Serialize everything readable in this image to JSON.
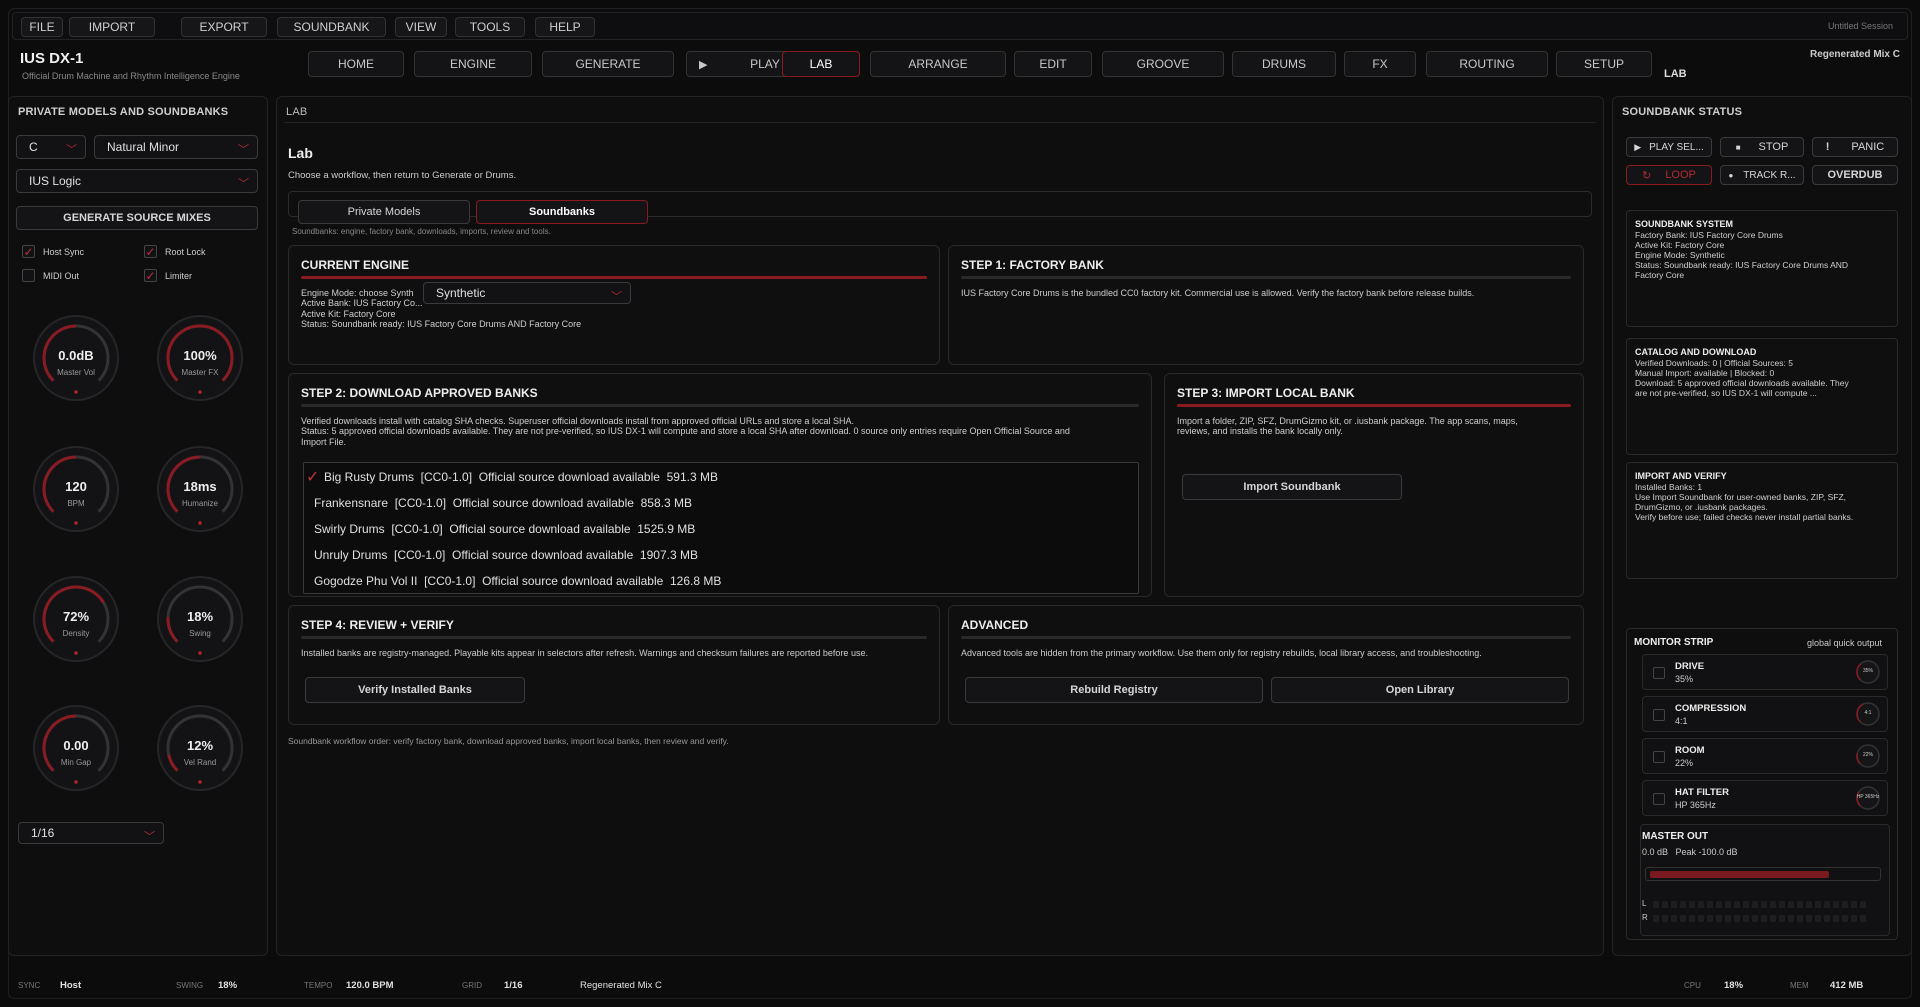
{
  "menu": {
    "file": "FILE",
    "import": "IMPORT",
    "export": "EXPORT",
    "soundbank": "SOUNDBANK",
    "view": "VIEW",
    "tools": "TOOLS",
    "help": "HELP",
    "session": "Untitled Session"
  },
  "app": {
    "title": "IUS DX-1",
    "subtitle": "Official Drum Machine and Rhythm Intelligence Engine",
    "mix": "Regenerated Mix C",
    "section": "LAB"
  },
  "nav": {
    "home": "HOME",
    "engine": "ENGINE",
    "generate": "GENERATE",
    "play": "PLAY",
    "lab": "LAB",
    "arrange": "ARRANGE",
    "edit": "EDIT",
    "groove": "GROOVE",
    "drums": "DRUMS",
    "fx": "FX",
    "routing": "ROUTING",
    "setup": "SETUP"
  },
  "left": {
    "title": "PRIVATE MODELS AND SOUNDBANKS",
    "key": "C",
    "scale": "Natural Minor",
    "model": "IUS Logic",
    "generate": "GENERATE SOURCE MIXES",
    "checks": {
      "host_sync": "Host Sync",
      "root_lock": "Root Lock",
      "midi_out": "MIDI Out",
      "limiter": "Limiter"
    },
    "knobs": [
      {
        "value": "0.0dB",
        "label": "Master Vol",
        "level": 0.5
      },
      {
        "value": "100%",
        "label": "Master FX",
        "level": 1.0
      },
      {
        "value": "120",
        "label": "BPM",
        "level": 0.5
      },
      {
        "value": "18ms",
        "label": "Humanize",
        "level": 0.5
      },
      {
        "value": "72%",
        "label": "Density",
        "level": 0.72
      },
      {
        "value": "18%",
        "label": "Swing",
        "level": 0.18
      },
      {
        "value": "0.00",
        "label": "Min Gap",
        "level": 0.5
      },
      {
        "value": "12%",
        "label": "Vel Rand",
        "level": 0.12
      }
    ],
    "grid": "1/16"
  },
  "lab": {
    "header": "LAB",
    "title": "Lab",
    "desc": "Choose a workflow, then return to Generate or Drums.",
    "tab_private": "Private Models",
    "tab_soundbanks": "Soundbanks",
    "tabs_note": "Soundbanks: engine, factory bank, downloads, imports, review and tools.",
    "engine": {
      "title": "CURRENT ENGINE",
      "l1": "Engine Mode: choose Synth",
      "l2": "Active Bank: IUS Factory Co...",
      "l3": "Active Kit: Factory Core",
      "l4": "Status: Soundbank ready: IUS Factory Core Drums AND Factory Core",
      "mode": "Synthetic"
    },
    "step1": {
      "title": "STEP 1: FACTORY BANK",
      "text": "IUS Factory Core Drums is the bundled CC0 factory kit. Commercial use is allowed. Verify the factory bank before release builds."
    },
    "step2": {
      "title": "STEP 2: DOWNLOAD APPROVED BANKS",
      "t1": "Verified downloads install with catalog SHA checks. Superuser official downloads install from approved official URLs and store a local SHA.",
      "t2": "Status: 5 approved official downloads available. They are not pre-verified, so IUS DX-1 will compute and store a local SHA after download. 0 source only entries require Open Official Source and",
      "t3": "Import File.",
      "banks": [
        "Big Rusty Drums  [CC0-1.0]  Official source download available  591.3 MB",
        "Frankensnare  [CC0-1.0]  Official source download available  858.3 MB",
        "Swirly Drums  [CC0-1.0]  Official source download available  1525.9 MB",
        "Unruly Drums  [CC0-1.0]  Official source download available  1907.3 MB",
        "Gogodze Phu Vol II  [CC0-1.0]  Official source download available  126.8 MB"
      ]
    },
    "step3": {
      "title": "STEP 3: IMPORT LOCAL BANK",
      "t1": "Import a folder, ZIP, SFZ, DrumGizmo kit, or .iusbank package. The app scans, maps,",
      "t2": "reviews, and installs the bank locally only.",
      "button": "Import Soundbank"
    },
    "step4": {
      "title": "STEP 4: REVIEW + VERIFY",
      "text": "Installed banks are registry-managed. Playable kits appear in selectors after refresh. Warnings and checksum failures are reported before use.",
      "button": "Verify Installed Banks"
    },
    "advanced": {
      "title": "ADVANCED",
      "text": "Advanced tools are hidden from the primary workflow. Use them only for registry rebuilds, local library access, and troubleshooting.",
      "rebuild": "Rebuild Registry",
      "open": "Open Library"
    },
    "footer": "Soundbank workflow order: verify factory bank, download approved banks, import local banks, then review and verify."
  },
  "right": {
    "title": "SOUNDBANK STATUS",
    "play_sel": "PLAY SEL...",
    "stop": "STOP",
    "panic": "PANIC",
    "loop": "LOOP",
    "track": "TRACK R...",
    "overdub": "OVERDUB",
    "system": {
      "title": "SOUNDBANK SYSTEM",
      "l1": "Factory Bank: IUS Factory Core Drums",
      "l2": "Active Kit: Factory Core",
      "l3": "Engine Mode: Synthetic",
      "l4": "Status: Soundbank ready: IUS Factory Core Drums AND",
      "l5": "Factory Core"
    },
    "catalog": {
      "title": "CATALOG AND DOWNLOAD",
      "l1": "Verified Downloads: 0 | Official Sources: 5",
      "l2": "Manual Import: available | Blocked: 0",
      "l3": "Download: 5 approved official downloads available. They",
      "l4": "are not pre-verified, so IUS DX-1 will compute ..."
    },
    "importv": {
      "title": "IMPORT AND VERIFY",
      "l1": "Installed Banks: 1",
      "l2": "Use Import Soundbank for user-owned banks, ZIP, SFZ,",
      "l3": "DrumGizmo, or .iusbank packages.",
      "l4": "Verify before use; failed checks never install partial banks."
    },
    "monitor": {
      "title": "MONITOR STRIP",
      "sub": "global quick output",
      "rows": [
        {
          "name": "DRIVE",
          "value": "35%",
          "knob": "35%",
          "level": 0.35
        },
        {
          "name": "COMPRESSION",
          "value": "4:1",
          "knob": "4:1",
          "level": 0.4
        },
        {
          "name": "ROOM",
          "value": "22%",
          "knob": "22%",
          "level": 0.22
        },
        {
          "name": "HAT FILTER",
          "value": "HP 365Hz",
          "knob": "HP 365Hz",
          "level": 0.3
        }
      ]
    },
    "master": {
      "title": "MASTER OUT",
      "value": "0.0 dB   Peak -100.0 dB",
      "level": 0.8,
      "l": "L",
      "r": "R"
    }
  },
  "status": {
    "sync_k": "SYNC",
    "sync": "Host",
    "swing_k": "SWING",
    "swing": "18%",
    "tempo_k": "TEMPO",
    "tempo": "120.0 BPM",
    "grid_k": "GRID",
    "grid": "1/16",
    "mix": "Regenerated Mix C",
    "cpu_k": "CPU",
    "cpu": "18%",
    "mem_k": "MEM",
    "mem": "412 MB"
  },
  "colors": {
    "accent": "#b0232c",
    "bg": "#0b0b0c"
  }
}
